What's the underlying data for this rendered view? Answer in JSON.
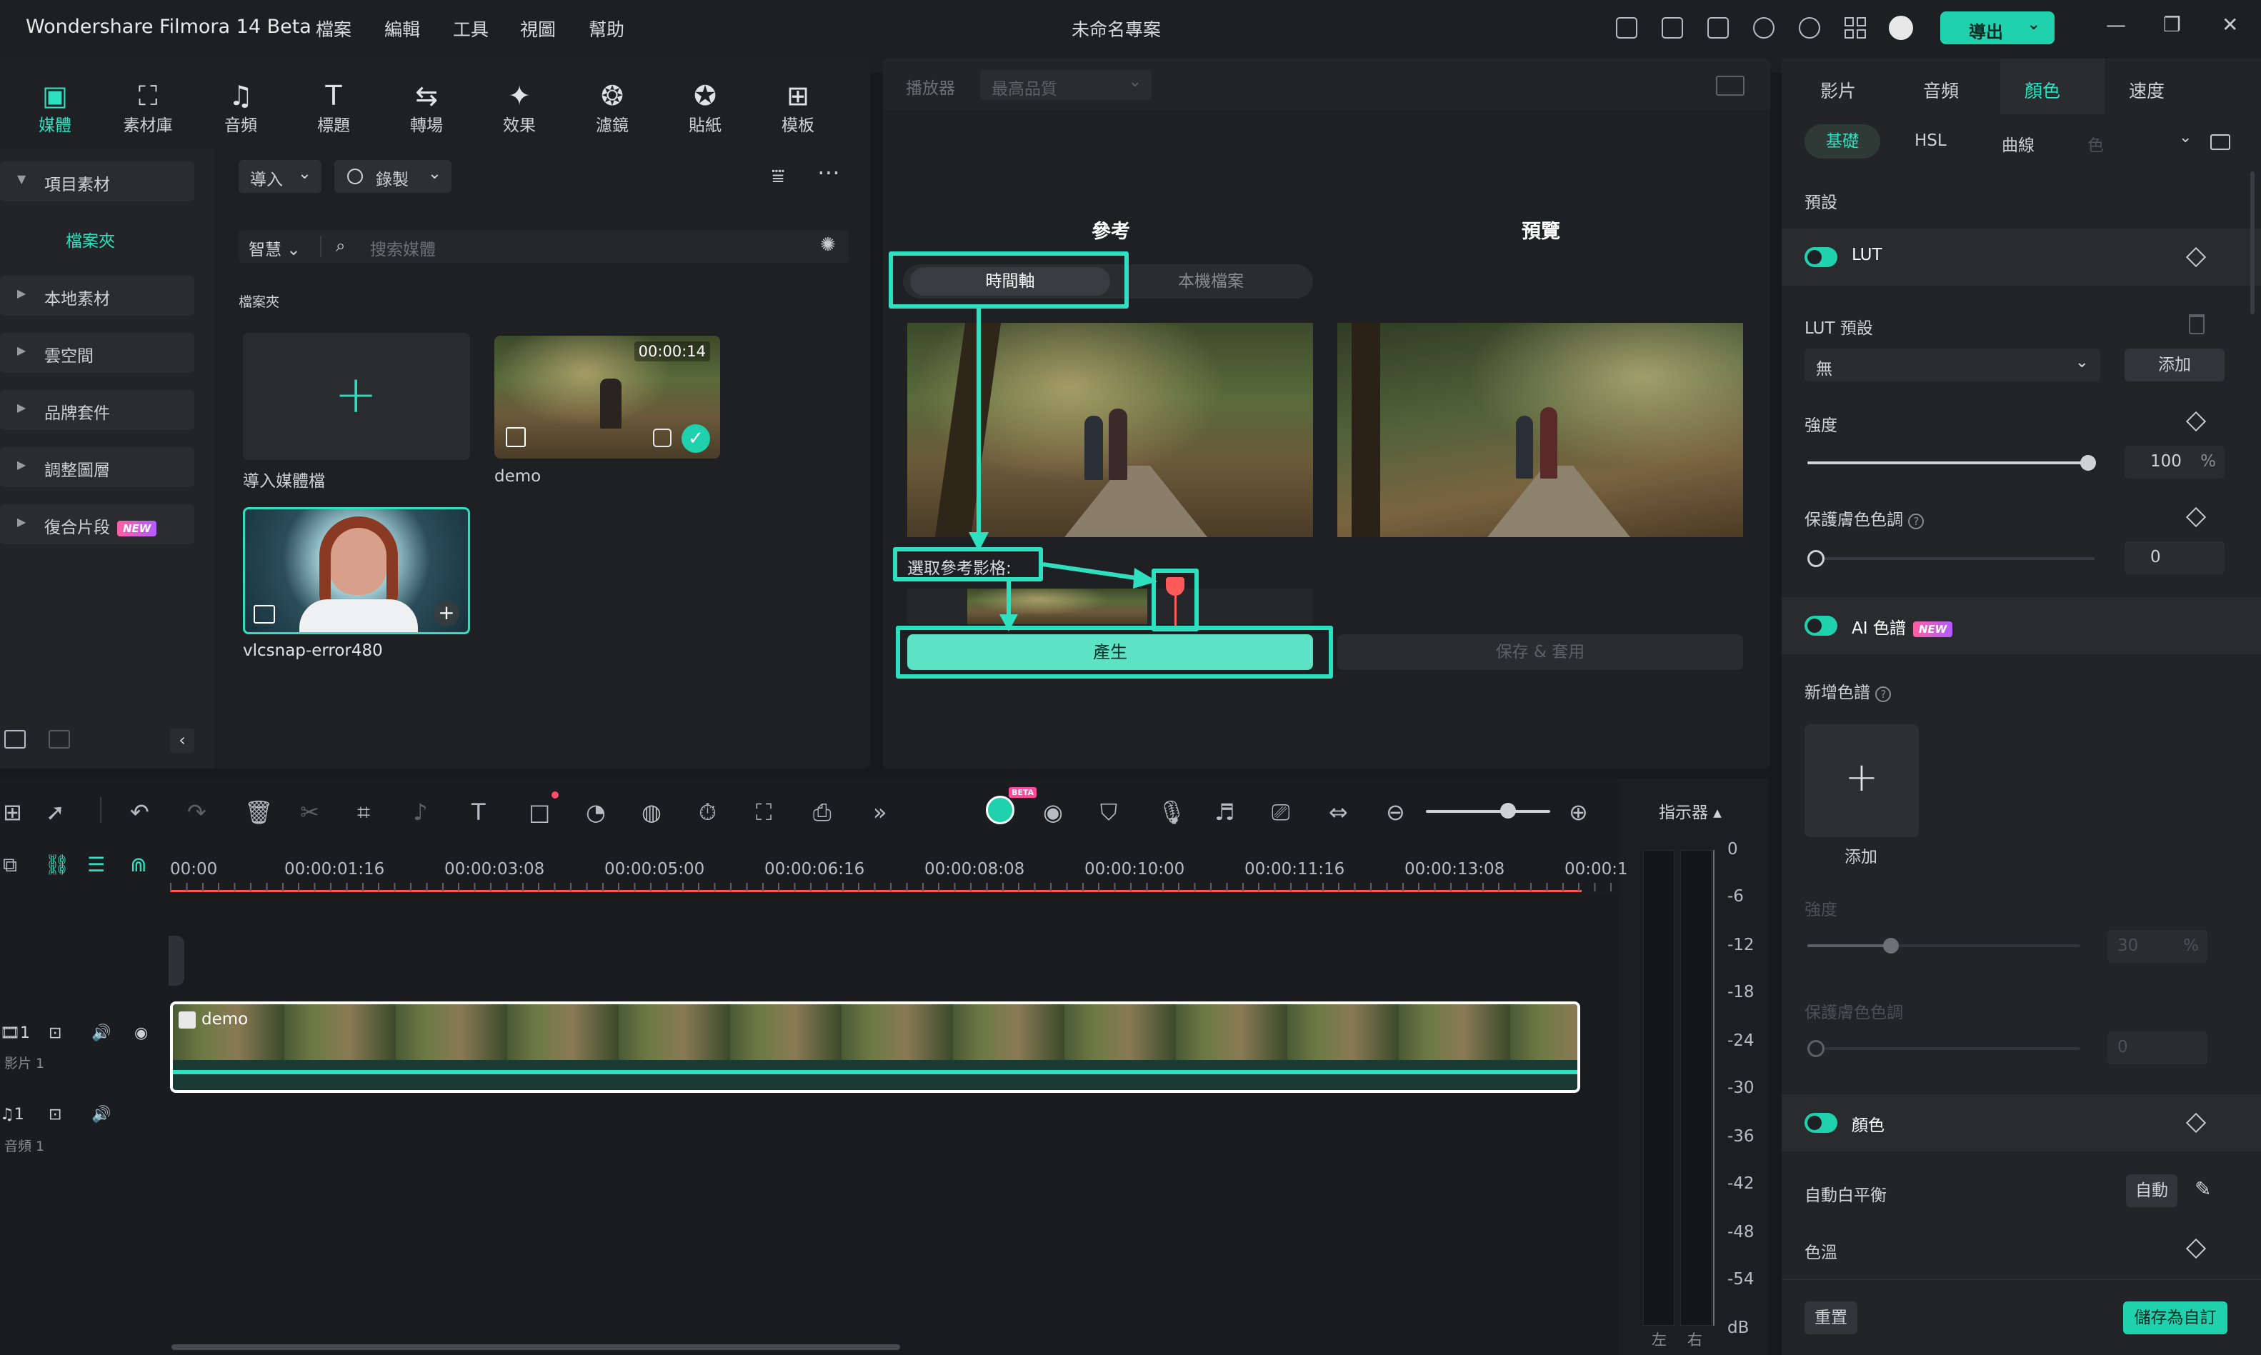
{
  "titlebar": {
    "app_name": "Wondershare Filmora 14 Beta",
    "menus": [
      "檔案",
      "編輯",
      "工具",
      "視圖",
      "幫助"
    ],
    "project_title": "未命名專案",
    "export_label": "導出"
  },
  "toolstrip": {
    "tools": [
      "媒體",
      "素材庫",
      "音頻",
      "標題",
      "轉場",
      "效果",
      "濾鏡",
      "貼紙",
      "模板"
    ],
    "active": "媒體"
  },
  "sidebar": {
    "items": [
      {
        "label": "項目素材",
        "expanded": true
      },
      {
        "label": "本地素材"
      },
      {
        "label": "雲空間"
      },
      {
        "label": "品牌套件"
      },
      {
        "label": "調整圖層"
      },
      {
        "label": "復合片段",
        "badge": "NEW"
      }
    ],
    "sub_folder": "檔案夾"
  },
  "media": {
    "import_label": "導入",
    "record_label": "錄製",
    "smart_label": "智慧",
    "search_placeholder": "搜索媒體",
    "folder_heading": "檔案夾",
    "import_tile_label": "導入媒體檔",
    "items": [
      {
        "name": "demo",
        "duration": "00:00:14"
      },
      {
        "name": "vlcsnap-error480"
      }
    ]
  },
  "player": {
    "label": "播放器",
    "quality": "最高品質",
    "reference_title": "參考",
    "preview_title": "預覽",
    "tab_timeline": "時間軸",
    "tab_local": "本機檔案",
    "select_ref_label": "選取參考影格:",
    "generate_label": "產生",
    "save_apply_label": "保存 & 套用"
  },
  "right_panel": {
    "tabs": [
      "影片",
      "音頻",
      "顏色",
      "速度"
    ],
    "active_tab": "顏色",
    "subtabs": [
      "基礎",
      "HSL",
      "曲線",
      "色"
    ],
    "active_subtab": "基礎",
    "preset_heading": "預設",
    "lut_label": "LUT",
    "lut_preset_label": "LUT 預設",
    "lut_preset_value": "無",
    "add_label": "添加",
    "strength_label": "強度",
    "strength_value": "100",
    "strength_unit": "%",
    "protect_skin_label": "保護膚色色調",
    "protect_skin_value": "0",
    "ai_palette_label": "AI 色譜",
    "ai_badge": "NEW",
    "new_palette_label": "新增色譜",
    "add_tile_label": "添加",
    "ai_strength_label": "強度",
    "ai_strength_value": "30",
    "ai_strength_unit": "%",
    "ai_protect_label": "保護膚色色調",
    "ai_protect_value": "0",
    "color_label": "顏色",
    "auto_wb_label": "自動白平衡",
    "auto_label": "自動",
    "temp_label": "色溫",
    "reset_label": "重置",
    "save_custom_label": "儲存為自訂"
  },
  "timeline": {
    "ruler_labels": [
      "00:00",
      "00:00:01:16",
      "00:00:03:08",
      "00:00:05:00",
      "00:00:06:16",
      "00:00:08:08",
      "00:00:10:00",
      "00:00:11:16",
      "00:00:13:08",
      "00:00:1"
    ],
    "video_track_label": "影片 1",
    "audio_track_label": "音頻 1",
    "track_number": "1",
    "clip_name": "demo",
    "meter_title": "指示器",
    "meter_scale": [
      "0",
      "-6",
      "-12",
      "-18",
      "-24",
      "-30",
      "-36",
      "-42",
      "-48",
      "-54",
      "dB"
    ],
    "meter_left": "左",
    "meter_right": "右",
    "beta_badge": "BETA"
  },
  "colors": {
    "accent": "#2ee0c0",
    "playhead": "#ff5a5a",
    "background": "#18191c"
  }
}
